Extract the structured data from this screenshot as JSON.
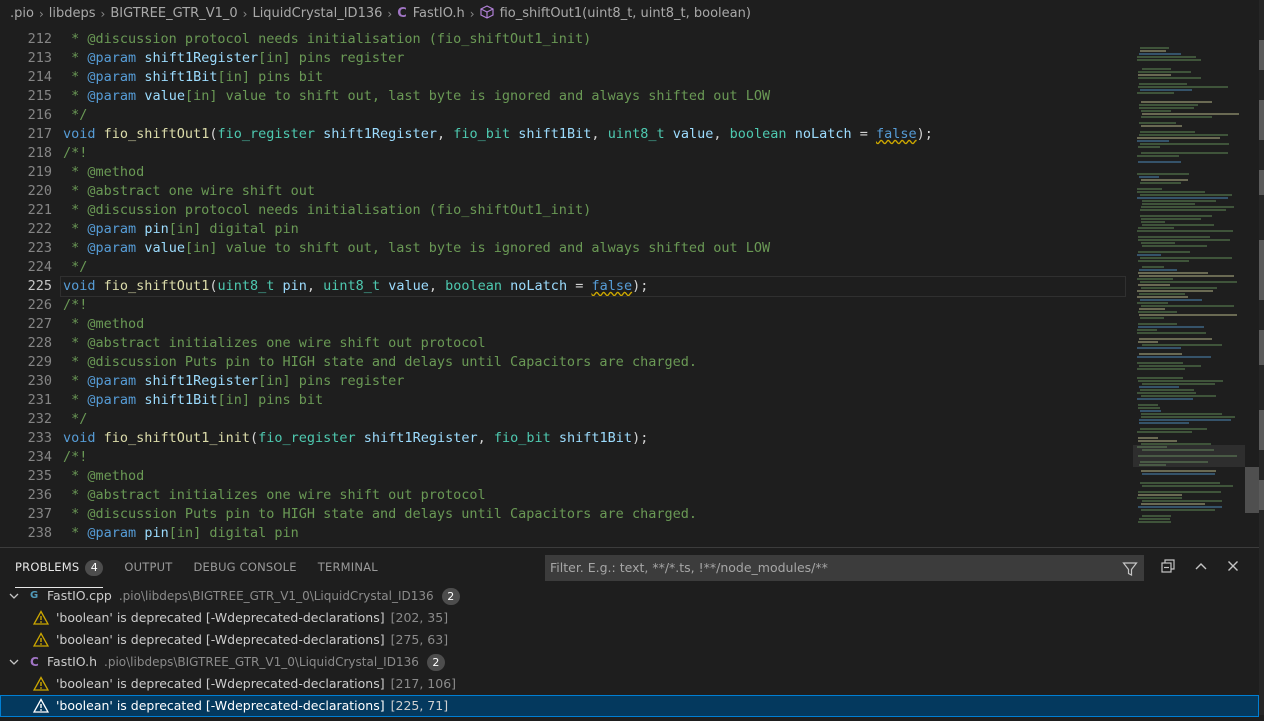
{
  "breadcrumb": {
    "items": [
      ".pio",
      "libdeps",
      "BIGTREE_GTR_V1_0",
      "LiquidCrystal_ID136"
    ],
    "file": "FastIO.h",
    "file_icon": "C",
    "symbol": "fio_shiftOut1(uint8_t, uint8_t, boolean)"
  },
  "editor": {
    "line_numbers": [
      "212",
      "213",
      "214",
      "215",
      "216",
      "217",
      "218",
      "219",
      "220",
      "221",
      "222",
      "223",
      "224",
      "225",
      "226",
      "227",
      "228",
      "229",
      "230",
      "231",
      "232",
      "233",
      "234",
      "235",
      "236",
      "237",
      "238"
    ],
    "current_line": "225"
  },
  "panel": {
    "tabs": [
      {
        "label": "PROBLEMS",
        "badge": "4",
        "active": true
      },
      {
        "label": "OUTPUT"
      },
      {
        "label": "DEBUG CONSOLE"
      },
      {
        "label": "TERMINAL"
      }
    ],
    "filter_placeholder": "Filter. E.g.: text, **/*.ts, !**/node_modules/**",
    "groups": [
      {
        "file": "FastIO.cpp",
        "icon": "C++",
        "path": ".pio\\libdeps\\BIGTREE_GTR_V1_0\\LiquidCrystal_ID136",
        "count": "2",
        "problems": [
          {
            "message": "'boolean' is deprecated [-Wdeprecated-declarations]",
            "location": "[202, 35]"
          },
          {
            "message": "'boolean' is deprecated [-Wdeprecated-declarations]",
            "location": "[275, 63]"
          }
        ]
      },
      {
        "file": "FastIO.h",
        "icon": "C",
        "path": ".pio\\libdeps\\BIGTREE_GTR_V1_0\\LiquidCrystal_ID136",
        "count": "2",
        "problems": [
          {
            "message": "'boolean' is deprecated [-Wdeprecated-declarations]",
            "location": "[217, 106]"
          },
          {
            "message": "'boolean' is deprecated [-Wdeprecated-declarations]",
            "location": "[225, 71]"
          }
        ]
      }
    ]
  },
  "colors": {
    "background": "#1e1e1e",
    "comment": "#6a9955",
    "keyword": "#569cd6",
    "type": "#4ec9b0",
    "function": "#dcdcaa",
    "variable": "#9cdcfe",
    "warning": "#cca700",
    "selection": "#04395e"
  }
}
